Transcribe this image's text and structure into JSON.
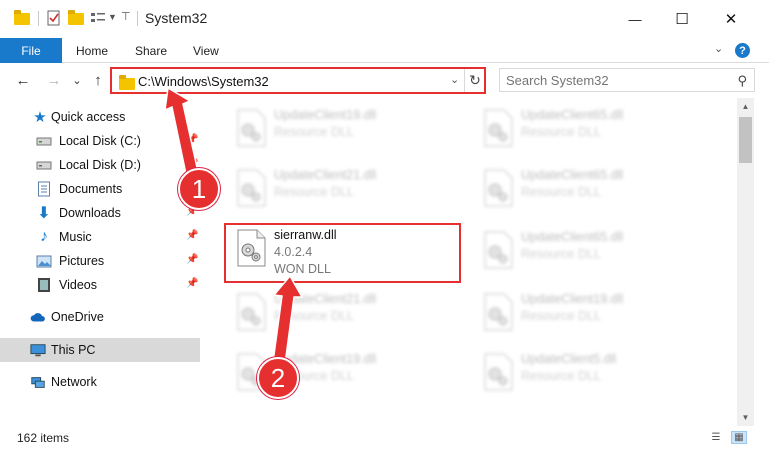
{
  "window": {
    "title": "System32",
    "minimize": "—",
    "maximize": "☐",
    "close": "✕"
  },
  "ribbon": {
    "tabs": [
      "File",
      "Home",
      "Share",
      "View"
    ],
    "help": "?"
  },
  "nav": {
    "back": "←",
    "forward": "→",
    "recent": "⌄",
    "up": "↑",
    "address": "C:\\Windows\\System32",
    "search_placeholder": "Search System32"
  },
  "sidebar": {
    "items": [
      {
        "label": "Quick access",
        "icon": "star-icon",
        "pinned": false
      },
      {
        "label": "Local Disk (C:)",
        "icon": "drive-icon",
        "pinned": true
      },
      {
        "label": "Local Disk (D:)",
        "icon": "drive-icon",
        "pinned": true
      },
      {
        "label": "Documents",
        "icon": "documents-icon",
        "pinned": true
      },
      {
        "label": "Downloads",
        "icon": "download-icon",
        "pinned": true
      },
      {
        "label": "Music",
        "icon": "music-icon",
        "pinned": true
      },
      {
        "label": "Pictures",
        "icon": "pictures-icon",
        "pinned": true
      },
      {
        "label": "Videos",
        "icon": "videos-icon",
        "pinned": true
      },
      {
        "label": "OneDrive",
        "icon": "cloud-icon",
        "pinned": false
      },
      {
        "label": "This PC",
        "icon": "computer-icon",
        "pinned": false,
        "selected": true
      },
      {
        "label": "Network",
        "icon": "network-icon",
        "pinned": false
      }
    ]
  },
  "files": {
    "left": [
      {
        "name": "UpdateClient19.dll",
        "type": "Resource DLL"
      },
      {
        "name": "UpdateClient21.dll",
        "type": "Resource DLL"
      },
      {
        "name": "sierranw.dll",
        "version": "4.0.2.4",
        "type": "WON DLL"
      },
      {
        "name": "UpdateClient21.dll",
        "type": "Resource DLL"
      },
      {
        "name": "UpdateClient19.dll",
        "type": "Resource DLL"
      }
    ],
    "right": [
      {
        "name": "UpdateClient65.dll",
        "type": "Resource DLL"
      },
      {
        "name": "UpdateClient65.dll",
        "type": "Resource DLL"
      },
      {
        "name": "UpdateClient65.dll",
        "type": "Resource DLL"
      },
      {
        "name": "UpdateClient19.dll",
        "type": "Resource DLL"
      },
      {
        "name": "UpdateClient5.dll",
        "type": "Resource DLL"
      }
    ]
  },
  "status": {
    "item_count": "162 items"
  },
  "annotations": {
    "step1": "1",
    "step2": "2",
    "color": "#e5302f"
  }
}
